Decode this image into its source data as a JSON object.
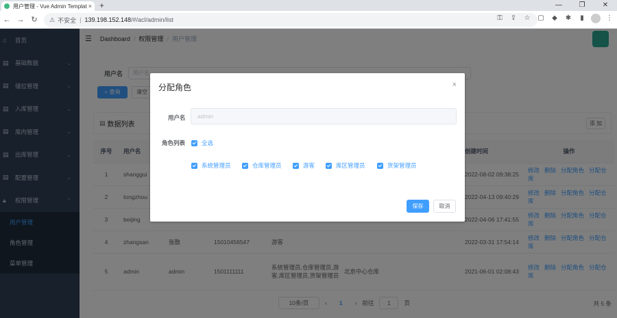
{
  "browser": {
    "tab_title": "用户管理 - Vue Admin Templat",
    "tab_close": "×",
    "new_tab": "+",
    "security": "不安全",
    "url_host": "139.198.152.148",
    "url_path": "/#/acl/admin/list",
    "win_min": "—",
    "win_max": "❐",
    "win_close": "✕"
  },
  "sidebar": {
    "items": [
      {
        "label": "首页",
        "icon": "home-icon"
      },
      {
        "label": "基础数据",
        "icon": "doc-icon"
      },
      {
        "label": "储位管理",
        "icon": "doc-icon"
      },
      {
        "label": "入库管理",
        "icon": "doc-icon"
      },
      {
        "label": "库内管理",
        "icon": "doc-icon"
      },
      {
        "label": "出库管理",
        "icon": "doc-icon"
      },
      {
        "label": "配置管理",
        "icon": "doc-icon"
      },
      {
        "label": "权限管理",
        "icon": "lock-icon"
      }
    ],
    "sub_items": [
      {
        "label": "用户管理",
        "active": true
      },
      {
        "label": "角色管理"
      },
      {
        "label": "菜单管理"
      }
    ]
  },
  "breadcrumb": {
    "home": "Dashboard",
    "section": "权限管理",
    "current": "用户管理"
  },
  "search": {
    "label": "用户名",
    "placeholder": "用户名",
    "query_button": "查询",
    "clear_button": "清空"
  },
  "card": {
    "title": "数据列表",
    "add_button": "添 加"
  },
  "table": {
    "headers": [
      "序号",
      "用户名",
      "",
      "",
      "",
      "",
      "",
      "",
      "创建时间",
      "操作"
    ],
    "rows": [
      {
        "no": "1",
        "username": "shanggui",
        "name": "",
        "phone": "",
        "roles": "",
        "warehouse": "",
        "created": "2022-08-02 09:38:25"
      },
      {
        "no": "2",
        "username": "tongzhou",
        "name": "",
        "phone": "",
        "roles": "",
        "warehouse": "",
        "created": "2022-04-13 09:40:29"
      },
      {
        "no": "3",
        "username": "beijing",
        "name": "",
        "phone": "",
        "roles": "",
        "warehouse": "",
        "created": "2022-04-06 17:41:55"
      },
      {
        "no": "4",
        "username": "zhangsan",
        "name": "张散",
        "phone": "15010456547",
        "roles": "游客",
        "warehouse": "",
        "created": "2022-03-31 17:54:14"
      },
      {
        "no": "5",
        "username": "admin",
        "name": "admin",
        "phone": "1501111111",
        "roles": "系统管理员,仓库管理员,游客,库区管理员,货架管理员",
        "warehouse": "北京中心仓库",
        "created": "2021-06-01 02:08:43"
      }
    ],
    "ops": [
      "修改",
      "删除",
      "分配角色",
      "分配仓库"
    ]
  },
  "pagination": {
    "page_size": "10条/页",
    "prev": "‹",
    "current": "1",
    "next": "›",
    "goto_label": "前往",
    "goto_value": "1",
    "goto_suffix": "页",
    "total": "共 5 条"
  },
  "dialog": {
    "title": "分配角色",
    "close": "×",
    "username_label": "用户名",
    "username_value": "admin",
    "roles_label": "角色列表",
    "select_all": "全选",
    "roles": [
      "系统管理员",
      "仓库管理员",
      "游客",
      "库区管理员",
      "货架管理员"
    ],
    "save_button": "保存",
    "cancel_button": "取消"
  },
  "colors": {
    "sidebar_bg": "#304156",
    "accent": "#409eff",
    "avatar": "#2ba58f"
  }
}
